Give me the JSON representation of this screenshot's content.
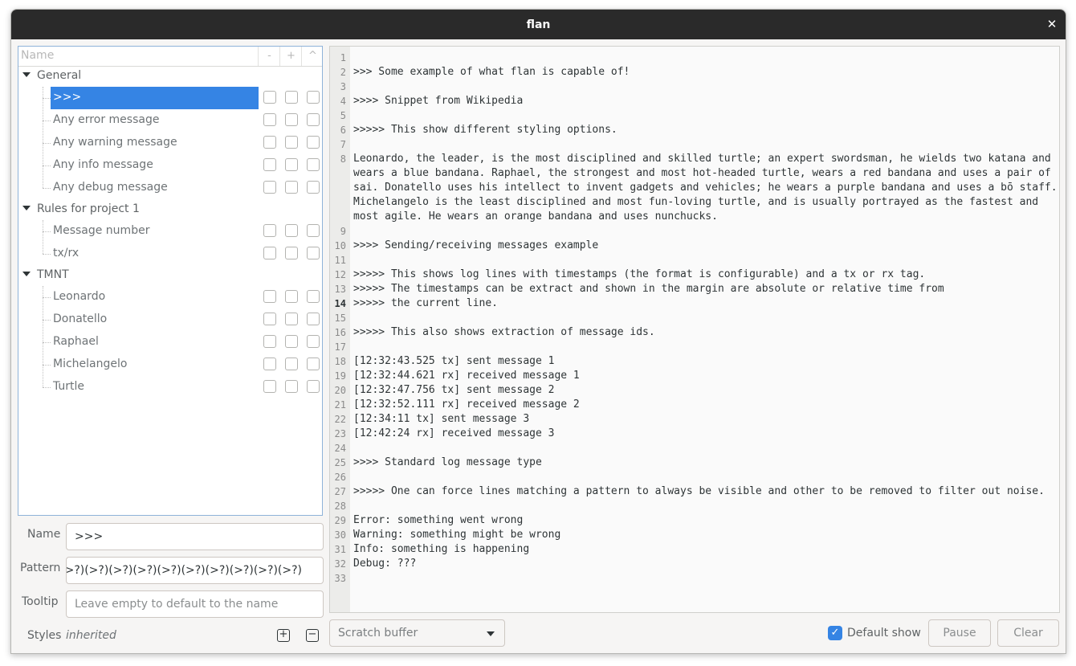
{
  "window": {
    "title": "flan"
  },
  "tree": {
    "header": {
      "name": "Name",
      "cols": [
        "-",
        "+",
        "^"
      ]
    },
    "groups": [
      {
        "label": "General",
        "rules": [
          ">>>",
          "Any error message",
          "Any warning message",
          "Any info message",
          "Any debug message"
        ]
      },
      {
        "label": "Rules for project 1",
        "rules": [
          "Message number",
          "tx/rx"
        ]
      },
      {
        "label": "TMNT",
        "rules": [
          "Leonardo",
          "Donatello",
          "Raphael",
          "Michelangelo",
          "Turtle"
        ]
      }
    ],
    "selected": ">>>"
  },
  "form": {
    "name_label": "Name",
    "name_value": ">>>",
    "pattern_label": "Pattern",
    "pattern_value": ">>>)(>?)(>?)(>?)(>?)(>?)(>?)(>?)(>?)(>?)(>?)",
    "tooltip_label": "Tooltip",
    "tooltip_placeholder": "Leave empty to default to the name",
    "styles_label": "Styles",
    "styles_value": "inherited"
  },
  "text": {
    "current_line": 14,
    "lines": [
      "",
      ">>> Some example of what flan is capable of!",
      "",
      ">>>> Snippet from Wikipedia",
      "",
      ">>>>> This show different styling options.",
      "",
      [
        "Leonardo, the leader, is the most disciplined and skilled turtle; an expert swordsman, he wields two katana and",
        "wears a blue bandana. Raphael, the strongest and most hot-headed turtle, wears a red bandana and uses a pair of",
        "sai. Donatello uses his intellect to invent gadgets and vehicles; he wears a purple bandana and uses a bō staff.",
        "Michelangelo is the least disciplined and most fun-loving turtle, and is usually portrayed as the fastest and",
        "most agile. He wears an orange bandana and uses nunchucks."
      ],
      "",
      ">>>> Sending/receiving messages example",
      "",
      ">>>>> This shows log lines with timestamps (the format is configurable) and a tx or rx tag.",
      ">>>>> The timestamps can be extract and shown in the margin are absolute or relative time from",
      ">>>>> the current line.",
      "",
      ">>>>> This also shows extraction of message ids.",
      "",
      "[12:32:43.525 tx] sent message 1",
      "[12:32:44.621 rx] received message 1",
      "[12:32:47.756 tx] sent message 2",
      "[12:32:52.111 rx] received message 2",
      "[12:34:11 tx] sent message 3",
      "[12:42:24 rx] received message 3",
      "",
      ">>>> Standard log message type",
      "",
      ">>>>> One can force lines matching a pattern to always be visible and other to be removed to filter out noise.",
      "",
      "Error: something went wrong",
      "Warning: something might be wrong",
      "Info: something is happening",
      "Debug: ???",
      ""
    ]
  },
  "bottom": {
    "buffer_select": "Scratch buffer",
    "default_show_label": "Default show",
    "default_show_checked": true,
    "pause_label": "Pause",
    "clear_label": "Clear"
  }
}
